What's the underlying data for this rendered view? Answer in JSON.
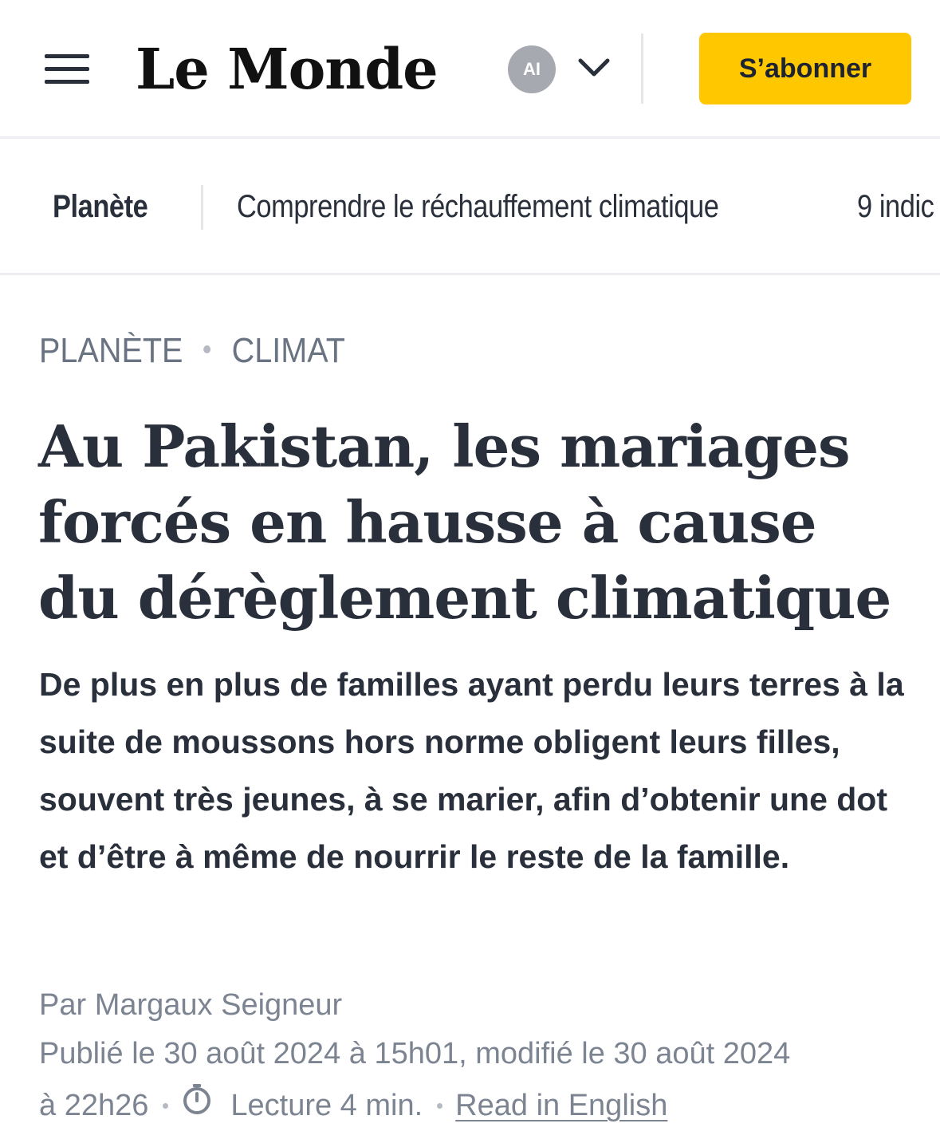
{
  "header": {
    "logo_text": "Le Monde",
    "avatar_initials": "AI",
    "subscribe_label": "S’abonner",
    "colors": {
      "subscribe_bg": "#ffc700",
      "avatar_bg": "#a6a9b0",
      "text": "#2a303b"
    },
    "icons": [
      "menu-icon",
      "chevron-down-icon"
    ]
  },
  "subnav": {
    "section": "Planète",
    "links": [
      "Comprendre le réchauffement climatique",
      "9 indic"
    ]
  },
  "article": {
    "kicker": [
      "PLANÈTE",
      "CLIMAT"
    ],
    "headline": "Au Pakistan, les mariages forcés en hausse à cause du dérèglement climatique",
    "standfirst": "De plus en plus de familles ayant perdu leurs terres à la suite de moussons hors norme obligent leurs filles, souvent très jeunes, à se marier, afin d’obtenir une dot et d’être à même de nourrir le reste de la famille.",
    "author": "Par Margaux Seigneur",
    "published_line1": "Publié le 30 août 2024 à 15h01, modifié le 30 août 2024",
    "published_line2": "à 22h26",
    "reading_time": "Lecture 4 min.",
    "read_in_english": "Read in English"
  }
}
